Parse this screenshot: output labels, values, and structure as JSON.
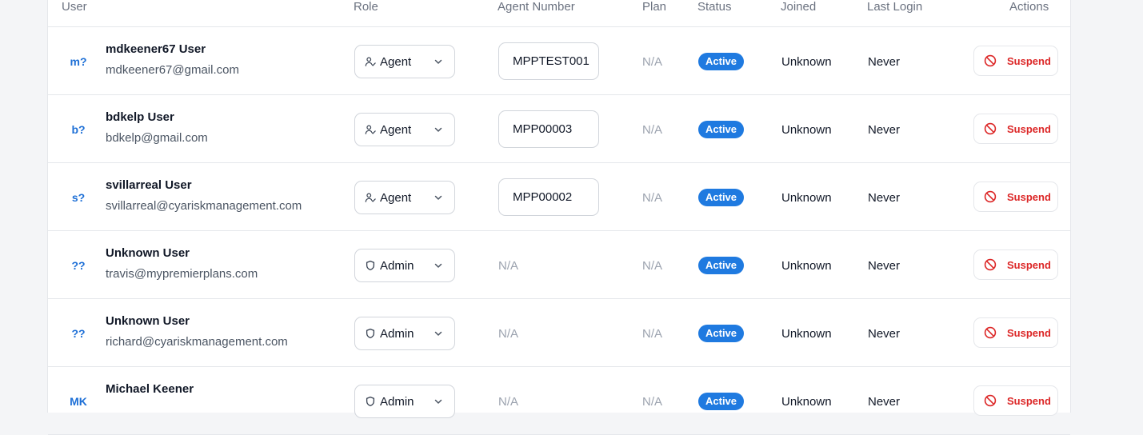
{
  "table": {
    "headers": {
      "user": "User",
      "role": "Role",
      "agent_number": "Agent Number",
      "plan": "Plan",
      "status": "Status",
      "joined": "Joined",
      "last_login": "Last Login",
      "actions": "Actions"
    },
    "rows": [
      {
        "initials": "m?",
        "name": "mdkeener67 User",
        "email": "mdkeener67@gmail.com",
        "role": "Agent",
        "role_icon": "user-check-icon",
        "agent_number": "MPPTEST001",
        "plan": "N/A",
        "status": "Active",
        "joined": "Unknown",
        "last_login": "Never",
        "action": "Suspend"
      },
      {
        "initials": "b?",
        "name": "bdkelp User",
        "email": "bdkelp@gmail.com",
        "role": "Agent",
        "role_icon": "user-check-icon",
        "agent_number": "MPP00003",
        "plan": "N/A",
        "status": "Active",
        "joined": "Unknown",
        "last_login": "Never",
        "action": "Suspend"
      },
      {
        "initials": "s?",
        "name": "svillarreal User",
        "email": "svillarreal@cyariskmanagement.com",
        "role": "Agent",
        "role_icon": "user-check-icon",
        "agent_number": "MPP00002",
        "plan": "N/A",
        "status": "Active",
        "joined": "Unknown",
        "last_login": "Never",
        "action": "Suspend"
      },
      {
        "initials": "??",
        "name": "Unknown User",
        "email": "travis@mypremierplans.com",
        "role": "Admin",
        "role_icon": "shield-icon",
        "agent_number": "N/A",
        "plan": "N/A",
        "status": "Active",
        "joined": "Unknown",
        "last_login": "Never",
        "action": "Suspend"
      },
      {
        "initials": "??",
        "name": "Unknown User",
        "email": "richard@cyariskmanagement.com",
        "role": "Admin",
        "role_icon": "shield-icon",
        "agent_number": "N/A",
        "plan": "N/A",
        "status": "Active",
        "joined": "Unknown",
        "last_login": "Never",
        "action": "Suspend"
      },
      {
        "initials": "MK",
        "name": "Michael Keener",
        "email": "",
        "role": "Admin",
        "role_icon": "shield-icon",
        "agent_number": "N/A",
        "plan": "N/A",
        "status": "Active",
        "joined": "Unknown",
        "last_login": "Never",
        "action": "Suspend"
      }
    ]
  },
  "colors": {
    "accent": "#1f7ae0",
    "danger": "#dc2626",
    "muted": "#9ca3af"
  }
}
